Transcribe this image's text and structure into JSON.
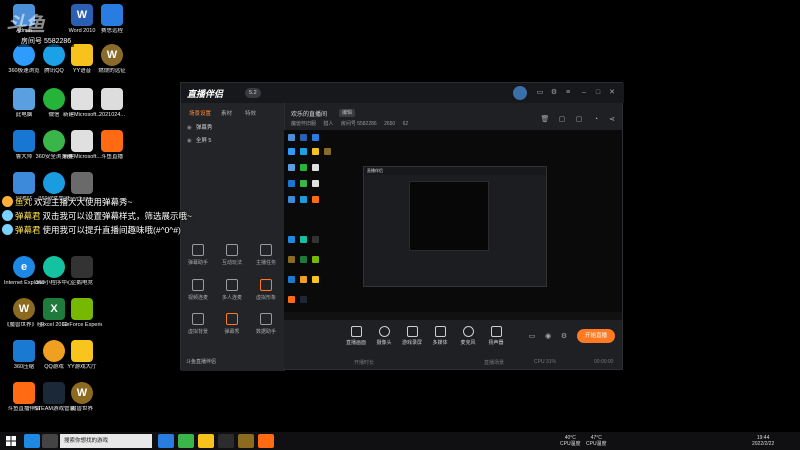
{
  "desktop": {
    "icons": [
      {
        "label": "Admin",
        "color": "#4a8fd8"
      },
      {
        "label": "Word 2010",
        "color": "#2b5fb4"
      },
      {
        "label": "赛思远程",
        "color": "#2a7de0"
      },
      {
        "label": "360极速浏览",
        "color": "#2e9bff"
      },
      {
        "label": "腾讯QQ",
        "color": "#1aa1e8"
      },
      {
        "label": "YY语音",
        "color": "#f6c21b"
      },
      {
        "label": "燃烧的远征",
        "color": "#8a6b2a"
      },
      {
        "label": "此电脑",
        "color": "#5aa0e0"
      },
      {
        "label": "微信",
        "color": "#25b33a"
      },
      {
        "label": "新建Microsoft...",
        "color": "#e0e0e0"
      },
      {
        "label": "2021024...",
        "color": "#dddddd"
      },
      {
        "label": "鲁大师",
        "color": "#1977d4"
      },
      {
        "label": "360安全浏览器",
        "color": "#39b54a"
      },
      {
        "label": "新建Microsoft...",
        "color": "#e0e0e0"
      },
      {
        "label": "斗鱼直播",
        "color": "#ff6a13"
      },
      {
        "label": "回收站",
        "color": "#3c8ad9"
      },
      {
        "label": "360软件管家",
        "color": "#1a9de0"
      },
      {
        "label": "buychann...",
        "color": "#6a6a6a"
      },
      {
        "label": "Internet Explorer",
        "color": "#1e88e5"
      },
      {
        "label": "360小程序中心",
        "color": "#14c1a0"
      },
      {
        "label": "企鹅电竞",
        "color": "#333333"
      },
      {
        "label": "《魔兽世界》经典怀旧服",
        "color": "#8c6a1f"
      },
      {
        "label": "Excel 2010",
        "color": "#1e7b3c"
      },
      {
        "label": "GeForce Experience",
        "color": "#76b900"
      },
      {
        "label": "360压缩",
        "color": "#1a79d0"
      },
      {
        "label": "QQ游戏",
        "color": "#f0a020"
      },
      {
        "label": "YY游戏大厅",
        "color": "#f7c51b"
      },
      {
        "label": "斗鱼直播伴侣",
        "color": "#ff6a13"
      },
      {
        "label": "STEAM游戏管家_dqx...",
        "color": "#1b2838"
      },
      {
        "label": "魔兽世界",
        "color": "#8c6a1f"
      }
    ],
    "watermark": "斗鱼",
    "room_label": "房间号",
    "room_number": "5582286"
  },
  "danmu": [
    {
      "name": "鱼丸",
      "text": "欢迎主播大大使用弹幕秀~",
      "avatar": "#ffb03b"
    },
    {
      "name": "弹幕君",
      "text": "双击我可以设置弹幕样式，筛选展示哦~",
      "avatar": "#7bd1ff"
    },
    {
      "name": "弹幕君",
      "text": "使用我可以提升直播间趣味哦(#^0^#)",
      "avatar": "#7bd1ff"
    }
  ],
  "app": {
    "logo": "直播伴侣",
    "badge": "5.2",
    "left_tabs": [
      "场景设置",
      "素材",
      "特效"
    ],
    "scenes": [
      "弹幕秀",
      "全屏 5"
    ],
    "tools_row1": [
      "弹幕助手",
      "互动玩法",
      "主播任务"
    ],
    "tools_row2": [
      "视频连麦",
      "多人连麦",
      "虚拟形象"
    ],
    "tools_row3": [
      "虚拟背景",
      "弹幕秀",
      "数据助手"
    ],
    "footer_left": "斗鱼直播伴侣",
    "room_title": "欢乐的直播间",
    "edit_label": "编辑",
    "room_meta": [
      "魔兽怀旧服",
      "猎人",
      "房间号 5582286",
      "2650",
      "62"
    ],
    "controls": [
      "直播画面",
      "摄像头",
      "游戏录屏",
      "多媒体",
      "麦克风",
      "扬声器"
    ],
    "start_button": "开始直播",
    "status": [
      "开播时长",
      "直播场景",
      "CPU 31%",
      "00:00:00"
    ]
  },
  "taskbar": {
    "search_placeholder": "搜索你想找的游戏",
    "temp_cpu": "40°C",
    "temp_cpu_label": "CPU温度",
    "temp_gpu": "47°C",
    "temp_gpu_label": "CPU温度",
    "clock_time": "19:44",
    "clock_date": "2022/2/22"
  }
}
